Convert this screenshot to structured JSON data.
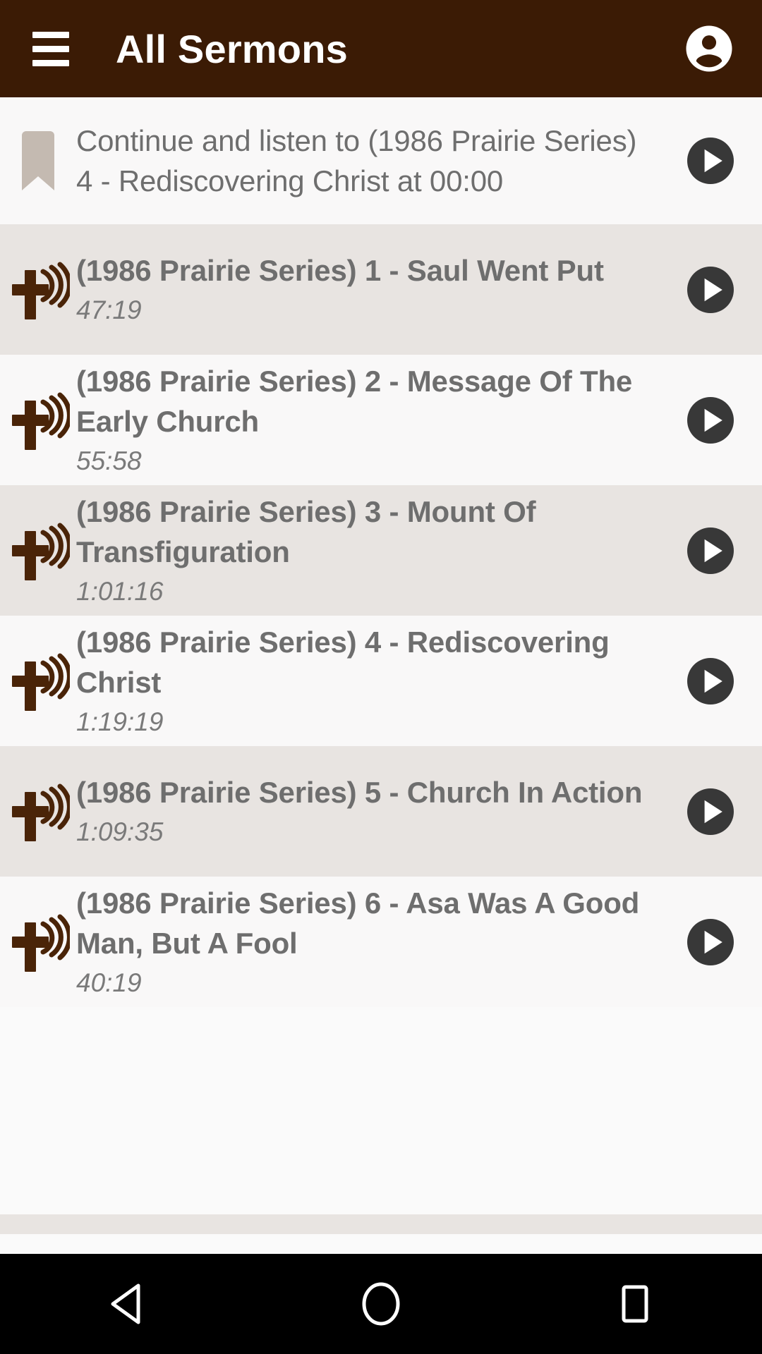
{
  "appbar": {
    "title": "All Sermons",
    "menu_icon": "hamburger-menu-icon",
    "avatar_icon": "account-circle-icon",
    "background_color": "#3B1B05"
  },
  "continue_row": {
    "icon": "bookmark-icon",
    "text": "Continue and listen to (1986 Prairie Series) 4 - Rediscovering Christ at 00:00",
    "play_icon": "play-circle-icon"
  },
  "list": {
    "item_icon": "cross-audio-icon",
    "play_icon": "play-circle-icon",
    "items": [
      {
        "title": "(1986 Prairie Series) 1 - Saul Went Put",
        "duration": "47:19"
      },
      {
        "title": "(1986 Prairie Series) 2 - Message Of The Early Church",
        "duration": "55:58"
      },
      {
        "title": "(1986 Prairie Series) 3 - Mount Of Transfiguration",
        "duration": "1:01:16"
      },
      {
        "title": "(1986 Prairie Series) 4 - Rediscovering Christ",
        "duration": "1:19:19"
      },
      {
        "title": "(1986 Prairie Series) 5 - Church In Action",
        "duration": "1:09:35"
      },
      {
        "title": "(1986 Prairie Series) 6 - Asa Was A Good Man, But A Fool",
        "duration": "40:19"
      }
    ]
  },
  "navbar": {
    "back_icon": "back-triangle-icon",
    "home_icon": "home-circle-icon",
    "recents_icon": "recents-square-icon"
  },
  "colors": {
    "brand_brown": "#3B1B05",
    "cross_brown": "#4A2408",
    "row_alt": "#E8E4E1",
    "row_base": "#F9F8F8",
    "text_grey": "#6E6E6E",
    "play_circle": "#383838",
    "bookmark": "#C4BAB1"
  }
}
